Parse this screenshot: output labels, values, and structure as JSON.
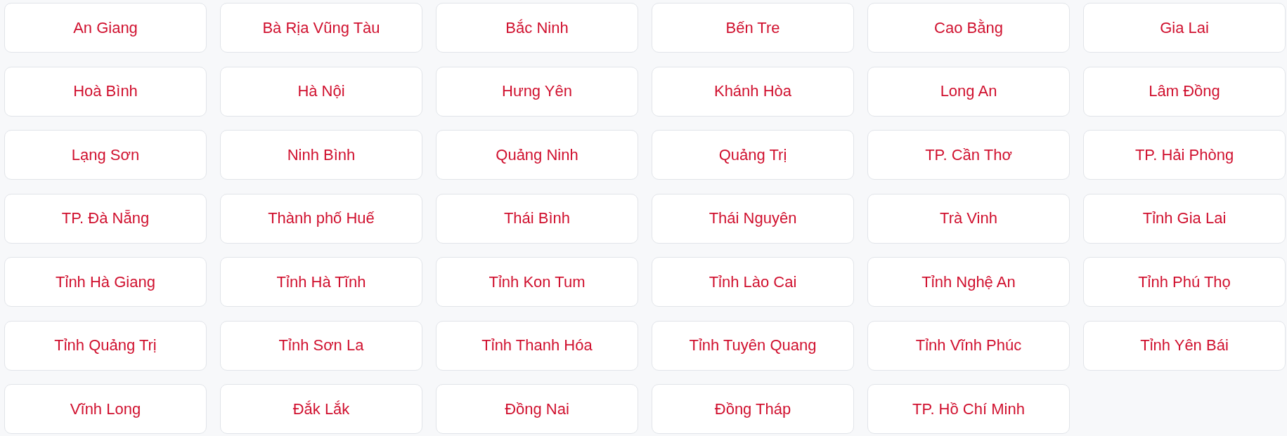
{
  "provinces": [
    {
      "label": "An Giang"
    },
    {
      "label": "Bà Rịa Vũng Tàu"
    },
    {
      "label": "Bắc Ninh"
    },
    {
      "label": "Bến Tre"
    },
    {
      "label": "Cao Bằng"
    },
    {
      "label": "Gia Lai"
    },
    {
      "label": "Hoà Bình"
    },
    {
      "label": "Hà Nội"
    },
    {
      "label": "Hưng Yên"
    },
    {
      "label": "Khánh Hòa"
    },
    {
      "label": "Long An"
    },
    {
      "label": "Lâm Đồng"
    },
    {
      "label": "Lạng Sơn"
    },
    {
      "label": "Ninh Bình"
    },
    {
      "label": "Quảng Ninh"
    },
    {
      "label": "Quảng Trị"
    },
    {
      "label": "TP. Cần Thơ"
    },
    {
      "label": "TP. Hải Phòng"
    },
    {
      "label": "TP. Đà Nẵng"
    },
    {
      "label": "Thành phố Huế"
    },
    {
      "label": "Thái Bình"
    },
    {
      "label": "Thái Nguyên"
    },
    {
      "label": "Trà Vinh"
    },
    {
      "label": "Tỉnh Gia Lai"
    },
    {
      "label": "Tỉnh Hà Giang"
    },
    {
      "label": "Tỉnh Hà Tĩnh"
    },
    {
      "label": "Tỉnh Kon Tum"
    },
    {
      "label": "Tỉnh Lào Cai"
    },
    {
      "label": "Tỉnh Nghệ An"
    },
    {
      "label": "Tỉnh Phú Thọ"
    },
    {
      "label": "Tỉnh Quảng Trị"
    },
    {
      "label": "Tỉnh Sơn La"
    },
    {
      "label": "Tỉnh Thanh Hóa"
    },
    {
      "label": "Tỉnh Tuyên Quang"
    },
    {
      "label": "Tỉnh Vĩnh Phúc"
    },
    {
      "label": "Tỉnh Yên Bái"
    },
    {
      "label": "Vĩnh Long"
    },
    {
      "label": "Đắk Lắk"
    },
    {
      "label": "Đồng Nai"
    },
    {
      "label": "Đồng Tháp"
    },
    {
      "label": "TP. Hồ Chí Minh"
    }
  ]
}
